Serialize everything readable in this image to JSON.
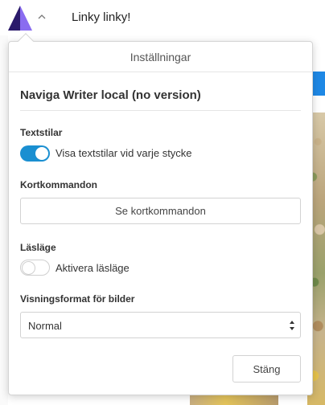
{
  "header": {
    "doc_title": "Linky linky!",
    "logo_icon": "naviga-triangle-logo",
    "menu_icon": "chevron-up-icon"
  },
  "popover": {
    "title": "Inställningar",
    "app_name": "Naviga Writer local (no version)",
    "sections": {
      "textstilar": {
        "label": "Textstilar",
        "toggle_label": "Visa textstilar vid varje stycke",
        "enabled": true
      },
      "kortkommandon": {
        "label": "Kortkommandon",
        "button_label": "Se kortkommandon"
      },
      "laslage": {
        "label": "Läsläge",
        "toggle_label": "Aktivera läsläge",
        "enabled": false
      },
      "visningsformat": {
        "label": "Visningsformat för bilder",
        "selected": "Normal"
      }
    },
    "close_label": "Stäng"
  },
  "colors": {
    "accent": "#1a8fd1",
    "logo_dark": "#2b1a6b",
    "logo_light": "#8a6cf0"
  }
}
